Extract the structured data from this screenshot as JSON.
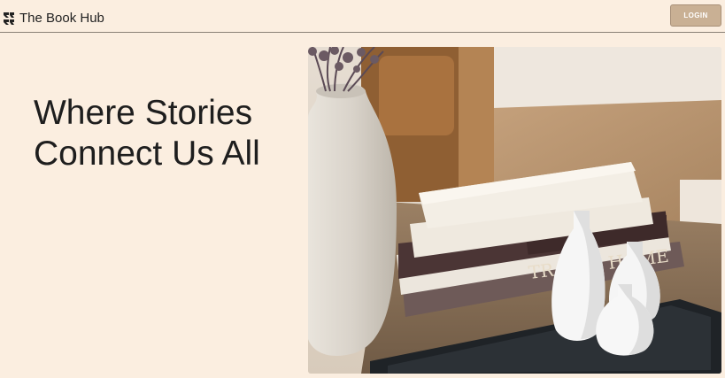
{
  "header": {
    "brand_name": "The Book Hub",
    "logo_icon": "stacked-chevrons-icon",
    "login_label": "LOGIN"
  },
  "hero": {
    "title_line1": "Where Stories",
    "title_line2": "Connect Us All",
    "image_icon": "books-and-vases-photo",
    "book_spine_text": "TRAVEL HOME"
  },
  "colors": {
    "background": "#fbeee0",
    "login_button": "#c9b094",
    "text": "#1e1e1e"
  }
}
